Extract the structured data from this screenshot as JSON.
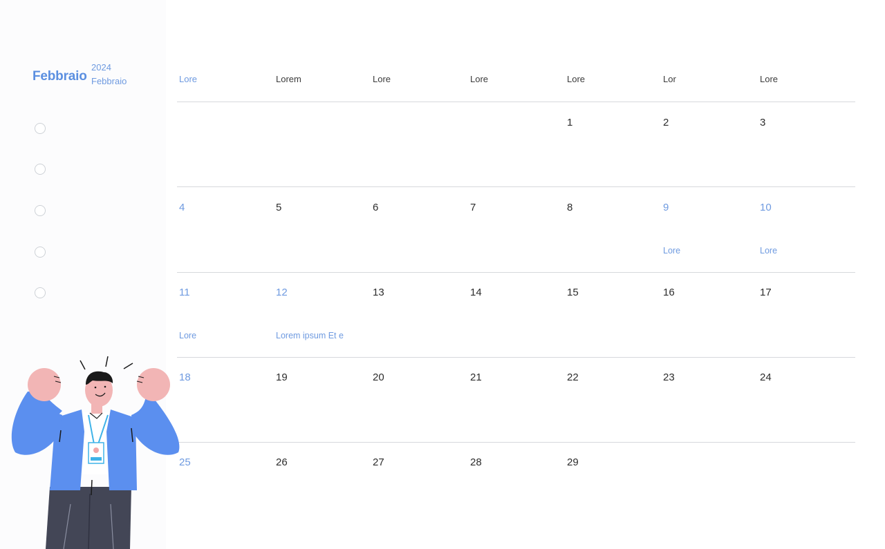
{
  "header": {
    "month": "Febbraio",
    "year": "2024",
    "month_sub": "Febbraio"
  },
  "sidebar": {
    "checkboxes": [
      {
        "checked": false
      },
      {
        "checked": false
      },
      {
        "checked": false
      },
      {
        "checked": false
      },
      {
        "checked": false
      }
    ]
  },
  "weekdays": [
    "Lore",
    "Lorem",
    "Lore",
    "Lore",
    "Lore",
    "Lor",
    "Lore"
  ],
  "weeks": [
    [
      null,
      null,
      null,
      null,
      "1",
      "2",
      "3"
    ],
    [
      "4",
      "5",
      "6",
      "7",
      "8",
      "9",
      "10"
    ],
    [
      "11",
      "12",
      "13",
      "14",
      "15",
      "16",
      "17"
    ],
    [
      "18",
      "19",
      "20",
      "21",
      "22",
      "23",
      "24"
    ],
    [
      "25",
      "26",
      "27",
      "28",
      "29",
      null,
      null
    ]
  ],
  "events": [
    {
      "day": "9",
      "text": "Lore"
    },
    {
      "day": "10",
      "text": "Lore"
    },
    {
      "day": "11",
      "text": "Lore"
    },
    {
      "day": "12",
      "text": "Lorem ipsum Et e"
    }
  ],
  "illustration": {
    "icon": "excited-person-illustration"
  },
  "colors": {
    "accent": "#5b8fe0",
    "accent_light": "#6e9ae0",
    "text": "#2c2c2c",
    "divider": "#d6d8dc",
    "jacket": "#5b8fef",
    "skin": "#f2b5b5",
    "pants": "#434656"
  }
}
